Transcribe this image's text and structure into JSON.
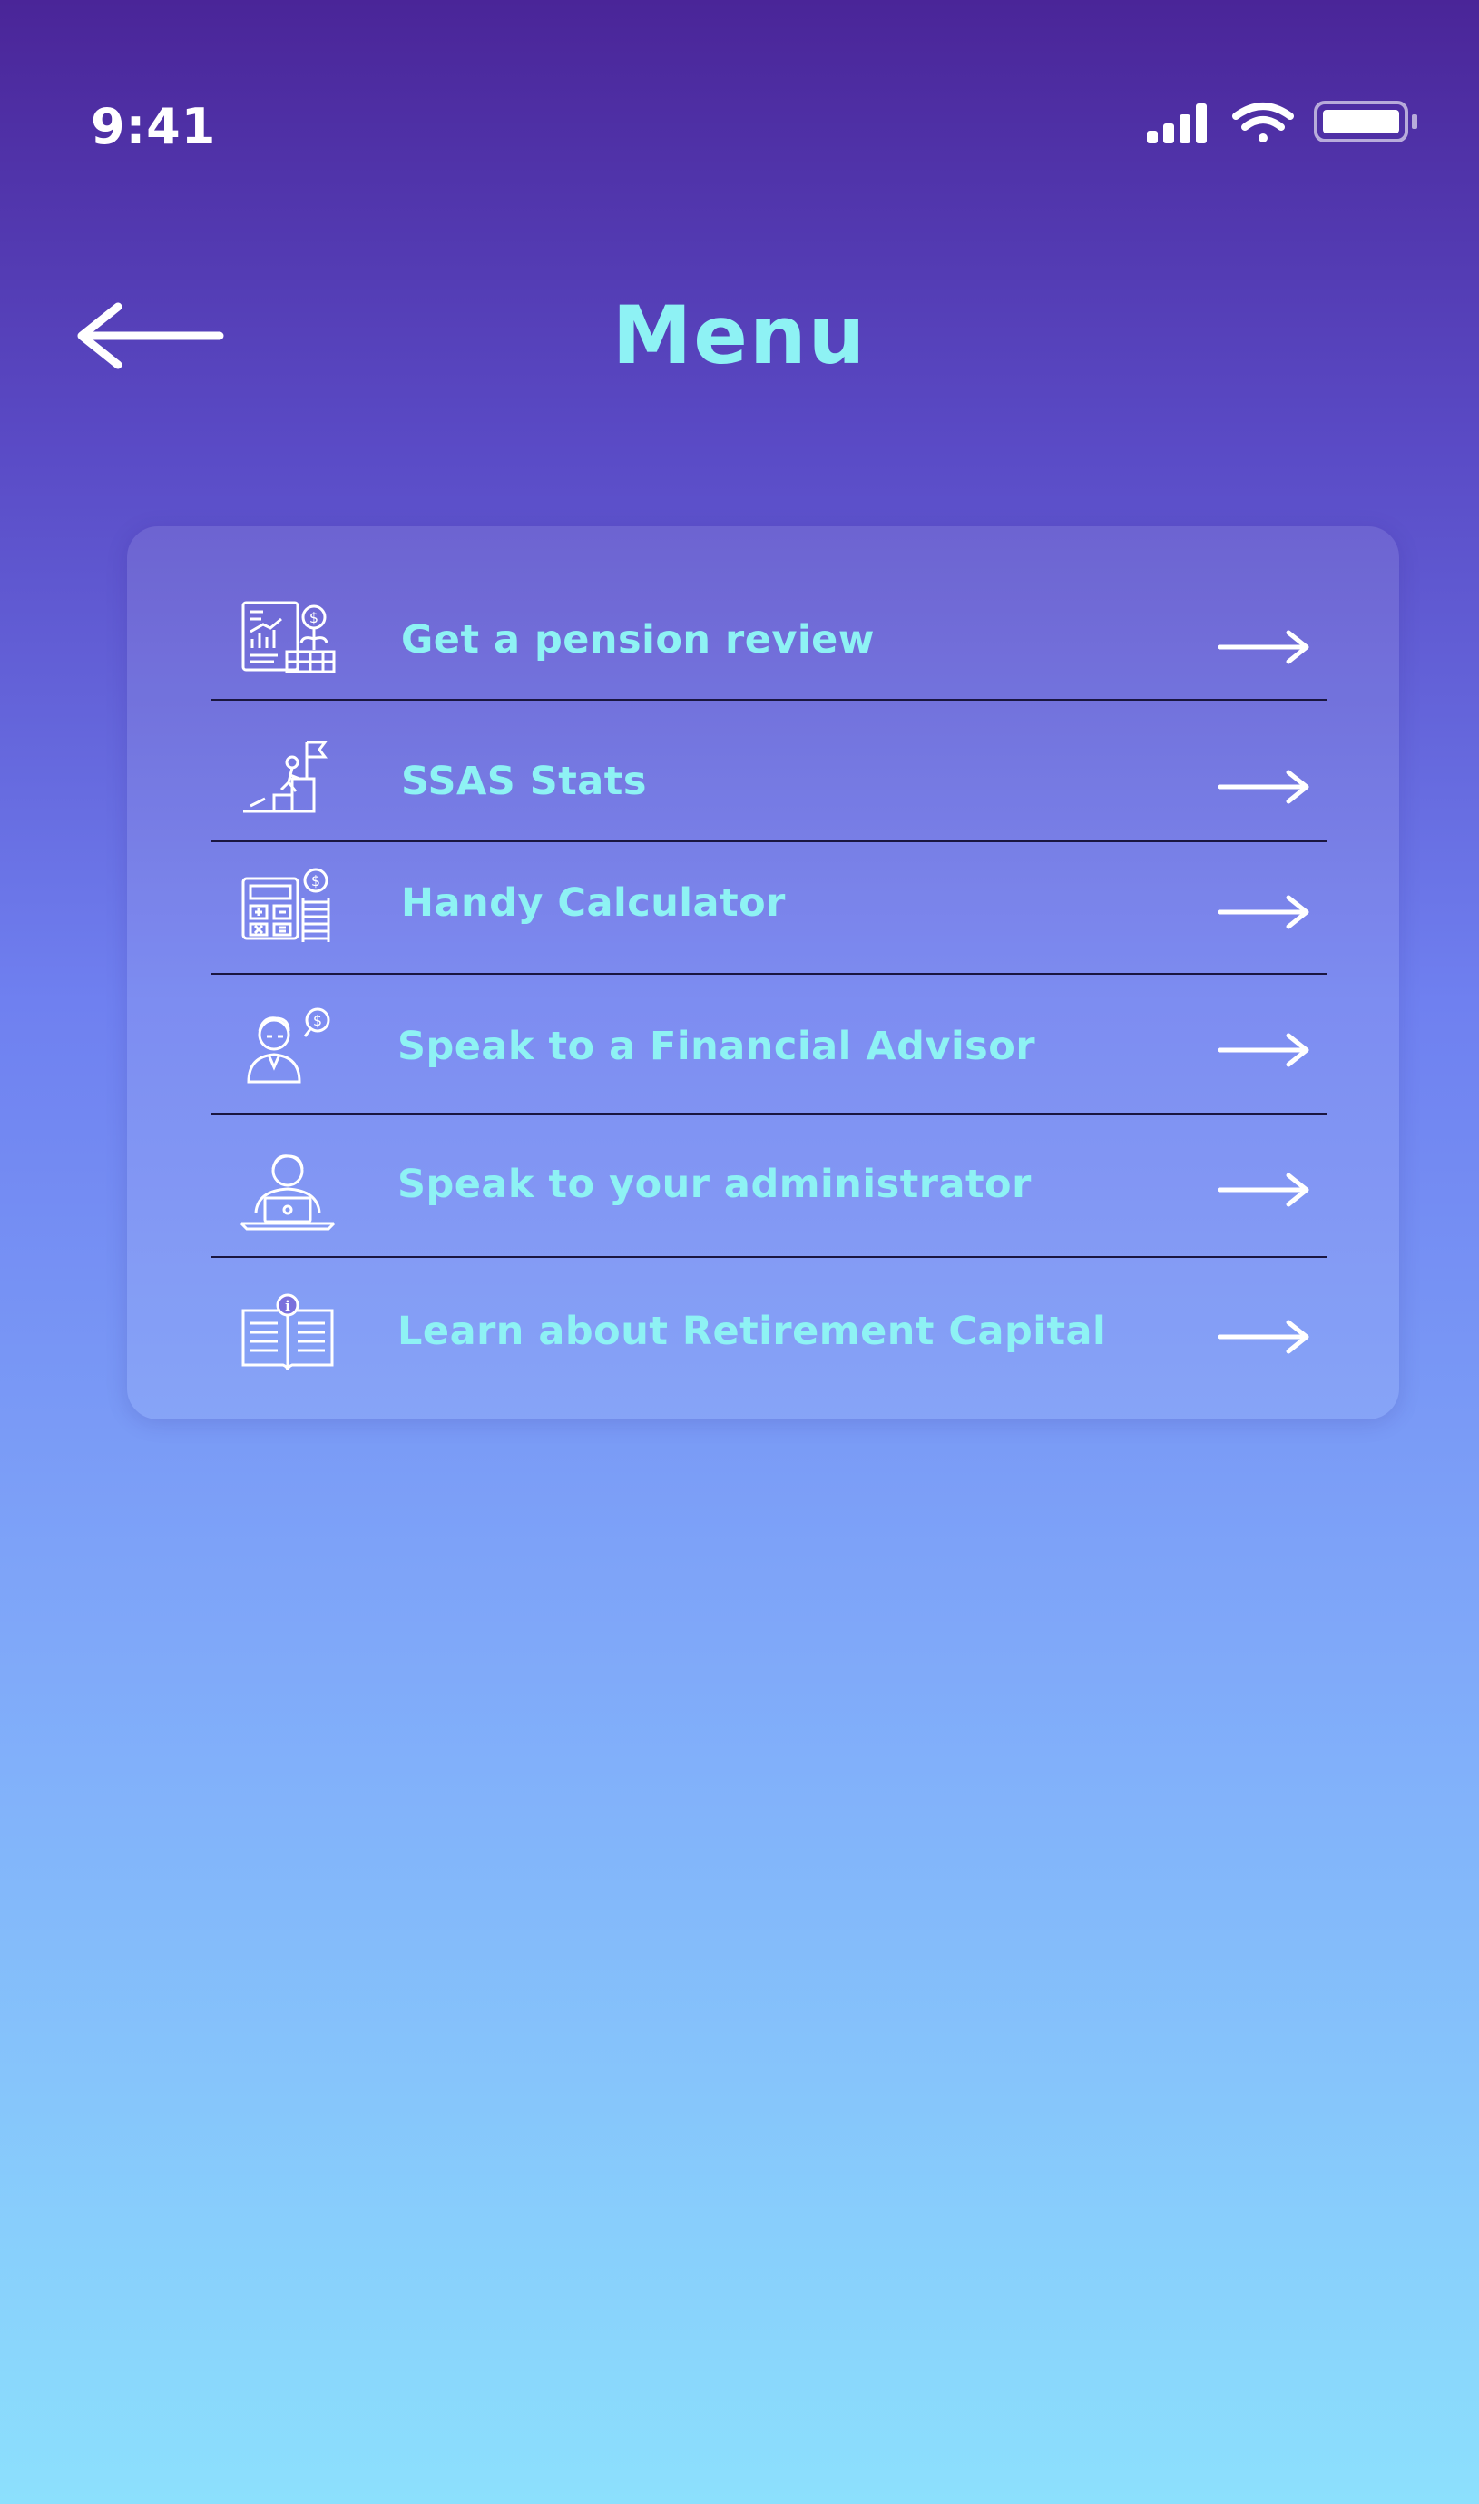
{
  "status_bar": {
    "time": "9:41"
  },
  "header": {
    "title": "Menu"
  },
  "menu": {
    "items": [
      {
        "label": "Get a pension review",
        "icon": "pension-report-icon"
      },
      {
        "label": "SSAS Stats",
        "icon": "stairs-flag-icon"
      },
      {
        "label": "Handy Calculator",
        "icon": "calculator-coins-icon"
      },
      {
        "label": "Speak to a Financial Advisor",
        "icon": "advisor-icon"
      },
      {
        "label": "Speak to your administrator",
        "icon": "administrator-laptop-icon"
      },
      {
        "label": "Learn about Retirement Capital",
        "icon": "info-book-icon"
      }
    ]
  },
  "colors": {
    "title": "#8ef2f4",
    "label": "#8ef2f4",
    "divider": "#1a1640",
    "gradient_top": "#4a2598",
    "gradient_bottom": "#8ce0fd"
  }
}
